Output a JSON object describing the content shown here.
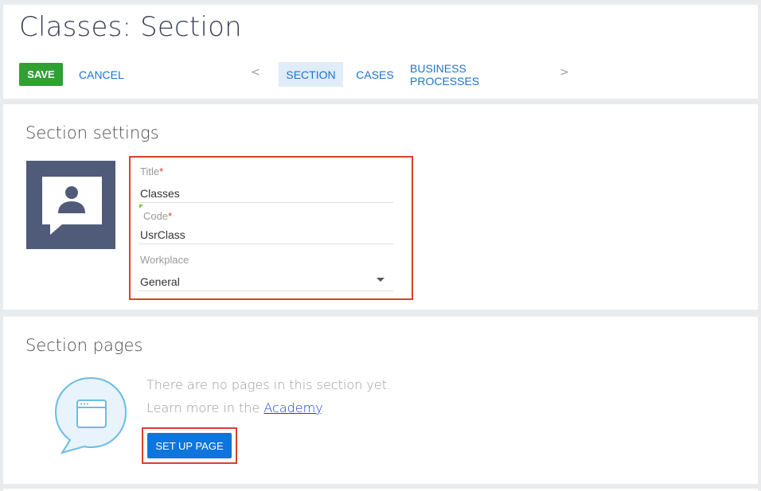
{
  "header": {
    "title": "Classes: Section",
    "save_label": "SAVE",
    "cancel_label": "CANCEL",
    "prev_arrow": "<",
    "next_arrow": ">",
    "tabs": [
      {
        "label": "SECTION",
        "active": true
      },
      {
        "label": "CASES",
        "active": false
      },
      {
        "label": "BUSINESS PROCESSES",
        "active": false
      }
    ]
  },
  "settings": {
    "heading": "Section settings",
    "image_icon": "person-presentation-icon",
    "fields": {
      "title": {
        "label": "Title",
        "required_mark": "*",
        "value": "Classes"
      },
      "code": {
        "label": "Code",
        "required_mark": "*",
        "value": "UsrClass"
      },
      "workplace": {
        "label": "Workplace",
        "value": "General"
      }
    }
  },
  "pages": {
    "heading": "Section pages",
    "empty_text": "There are no pages in this section yet.",
    "learn_prefix": "Learn more in the ",
    "academy_link": "Academy",
    "learn_suffix": ".",
    "setup_button": "SET UP PAGE",
    "illustration_icon": "browser-window-speech-bubble-icon"
  },
  "colors": {
    "save_green": "#30a033",
    "link_blue": "#1e73c8",
    "setup_blue": "#0e75dc",
    "highlight_red": "#d9412e",
    "image_bg": "#4f5b78",
    "active_tab_bg": "#e0ecf8"
  }
}
